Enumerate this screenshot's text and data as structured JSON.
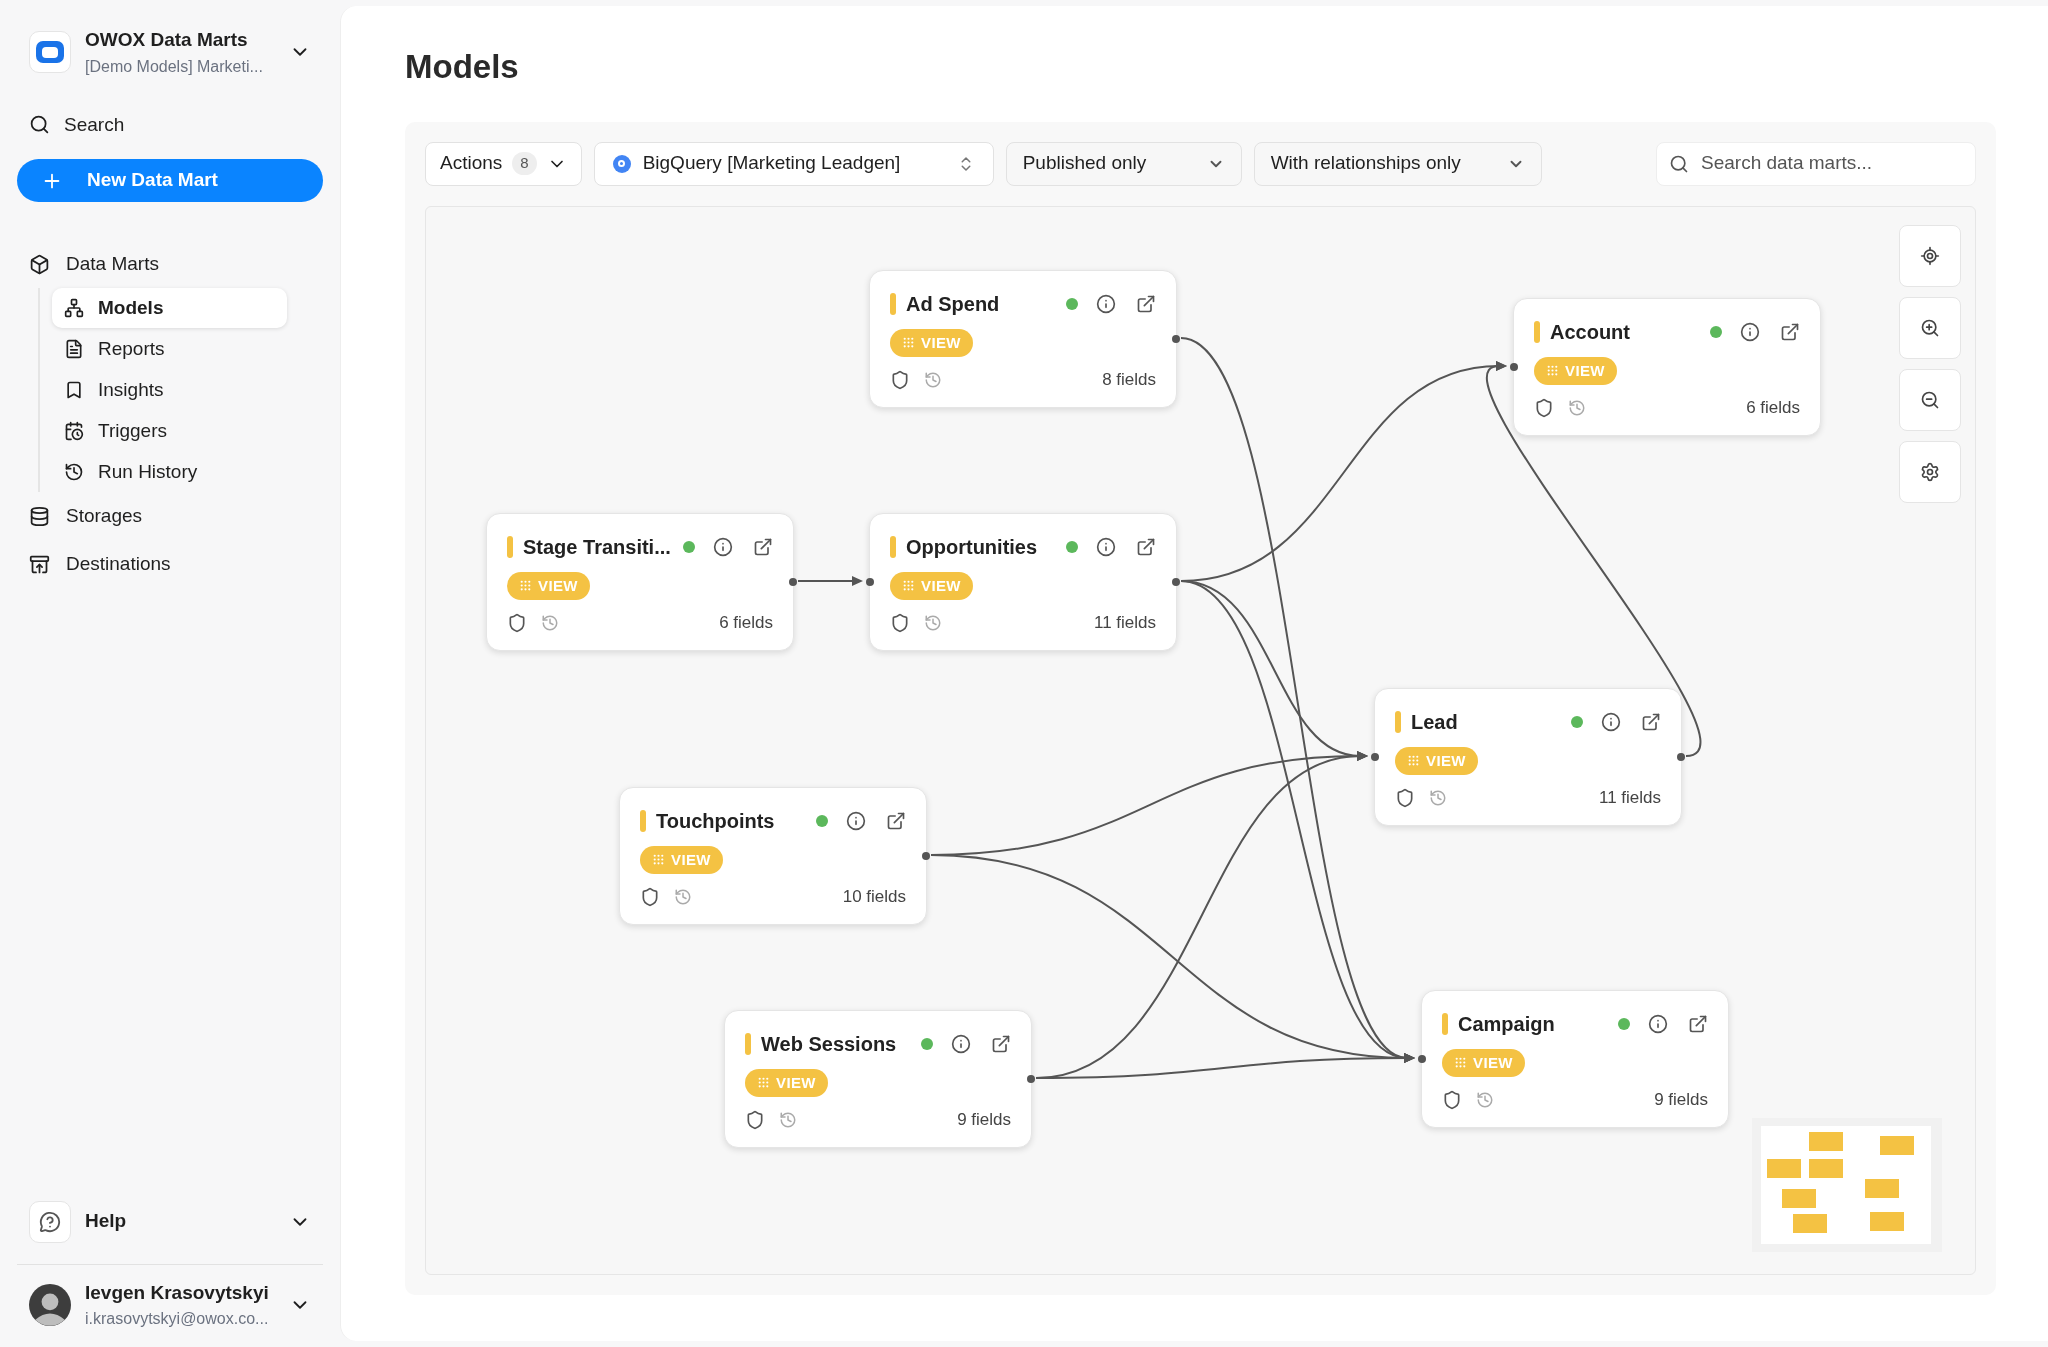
{
  "sidebar": {
    "workspace": {
      "name": "OWOX Data Marts",
      "subtitle": "[Demo Models] Marketi..."
    },
    "search": "Search",
    "new_button": "New Data Mart",
    "nav": [
      {
        "label": "Data Marts",
        "selected": false,
        "children": [
          {
            "label": "Models",
            "selected": true
          },
          {
            "label": "Reports",
            "selected": false
          },
          {
            "label": "Insights",
            "selected": false
          },
          {
            "label": "Triggers",
            "selected": false
          },
          {
            "label": "Run History",
            "selected": false
          }
        ]
      },
      {
        "label": "Storages",
        "selected": false
      },
      {
        "label": "Destinations",
        "selected": false
      }
    ],
    "help": "Help",
    "user": {
      "name": "Ievgen Krasovytskyi",
      "email": "i.krasovytskyi@owox.co..."
    }
  },
  "page": {
    "title": "Models"
  },
  "toolbar": {
    "actions": {
      "label": "Actions",
      "count": "8"
    },
    "storage": "BigQuery [Marketing Leadgen]",
    "filters": [
      "Published only",
      "With relationships only"
    ],
    "search": {
      "placeholder": "Search data marts..."
    }
  },
  "nodes": [
    {
      "title": "Ad Spend",
      "published": true,
      "type": "VIEW",
      "fields": "8 fields"
    },
    {
      "title": "Account",
      "published": true,
      "type": "VIEW",
      "fields": "6 fields"
    },
    {
      "title": "Stage Transiti...",
      "published": true,
      "type": "VIEW",
      "fields": "6 fields"
    },
    {
      "title": "Opportunities",
      "published": true,
      "type": "VIEW",
      "fields": "11 fields"
    },
    {
      "title": "Lead",
      "published": true,
      "type": "VIEW",
      "fields": "11 fields"
    },
    {
      "title": "Touchpoints",
      "published": true,
      "type": "VIEW",
      "fields": "10 fields"
    },
    {
      "title": "Web Sessions",
      "published": true,
      "type": "VIEW",
      "fields": "9 fields"
    },
    {
      "title": "Campaign",
      "published": true,
      "type": "VIEW",
      "fields": "9 fields"
    }
  ]
}
